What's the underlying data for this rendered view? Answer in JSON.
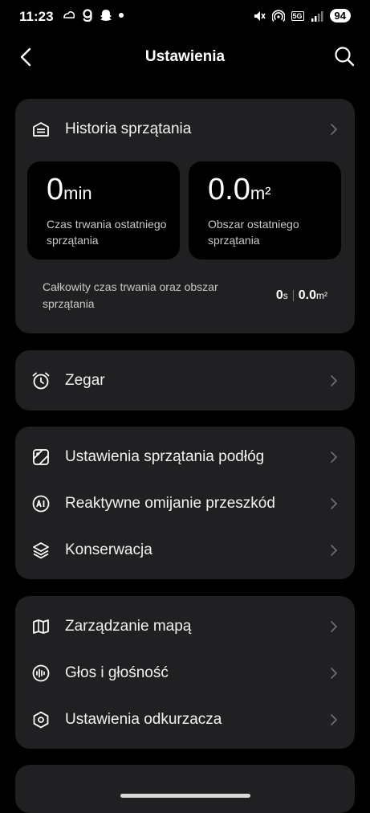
{
  "status_bar": {
    "time": "11:23",
    "left_icons": [
      "weather-icon",
      "g-app-icon",
      "snapchat-icon",
      "dot-icon"
    ],
    "network": "5G",
    "battery": "94"
  },
  "header": {
    "title": "Ustawienia"
  },
  "history_card": {
    "label": "Historia sprzątania",
    "last_duration": {
      "value": "0",
      "unit": "min",
      "desc": "Czas trwania ostatniego sprzątania"
    },
    "last_area": {
      "value": "0.0",
      "unit": "m²",
      "desc": "Obszar ostatniego sprzątania"
    },
    "total_desc": "Całkowity czas trwania oraz obszar sprzątania",
    "total_time": {
      "value": "0",
      "unit": "s"
    },
    "total_area": {
      "value": "0.0",
      "unit": "m²"
    }
  },
  "clock_card": {
    "label": "Zegar"
  },
  "cleaning_card": {
    "items": [
      {
        "label": "Ustawienia sprzątania podłóg",
        "icon": "floor-settings-icon"
      },
      {
        "label": "Reaktywne omijanie przeszkód",
        "icon": "ai-icon"
      },
      {
        "label": "Konserwacja",
        "icon": "layers-icon"
      }
    ]
  },
  "device_card": {
    "items": [
      {
        "label": "Zarządzanie mapą",
        "icon": "map-icon"
      },
      {
        "label": "Głos i głośność",
        "icon": "voice-icon"
      },
      {
        "label": "Ustawienia odkurzacza",
        "icon": "hexagon-icon"
      }
    ]
  },
  "colors": {
    "background": "#000000",
    "card": "#202023",
    "stat_box": "#000000"
  }
}
